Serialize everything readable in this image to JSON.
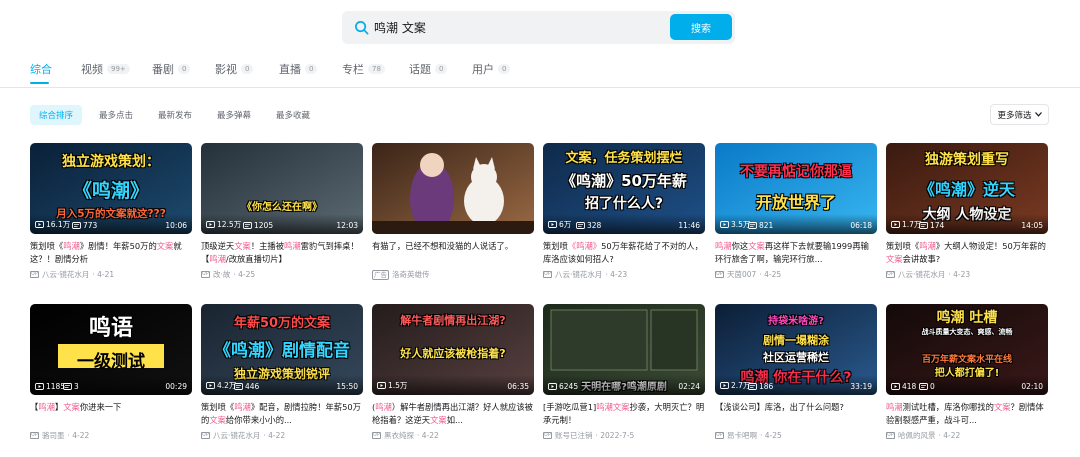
{
  "search": {
    "query": "鸣潮 文案",
    "button_label": "搜索"
  },
  "tabs": [
    {
      "label": "综合",
      "count": ""
    },
    {
      "label": "视频",
      "count": "99+"
    },
    {
      "label": "番剧",
      "count": "0"
    },
    {
      "label": "影视",
      "count": "0"
    },
    {
      "label": "直播",
      "count": "0"
    },
    {
      "label": "专栏",
      "count": "78"
    },
    {
      "label": "话题",
      "count": "0"
    },
    {
      "label": "用户",
      "count": "0"
    }
  ],
  "sort_options": [
    "综合排序",
    "最多点击",
    "最新发布",
    "最多弹幕",
    "最多收藏"
  ],
  "filter_label": "更多筛选",
  "colors": {
    "accent": "#00aeec",
    "highlight": "#f25d8e",
    "text": "#18191c",
    "muted": "#9499a0"
  },
  "cards": [
    {
      "thumb_lines": [
        "独立游戏策划：",
        "《鸣潮》",
        "月入5万的文案就这???"
      ],
      "views": "16.1万",
      "danmaku": "773",
      "duration": "10:06",
      "title_parts": [
        "策划喷《",
        "鸣潮",
        "》剧情！年薪50万的",
        "文案",
        "就这？！剧情分析"
      ],
      "up": "八云·镜花水月",
      "date": "4-21",
      "ad": false
    },
    {
      "thumb_lines": [
        "《你怎么还在啊》"
      ],
      "views": "12.5万",
      "danmaku": "1205",
      "duration": "12:03",
      "title_parts": [
        "顶级逆天",
        "文案",
        "！主播被",
        "鸣潮",
        "雷豹气到摔桌！【",
        "鸣潮",
        "/改放直播切片】"
      ],
      "up": "改·故",
      "date": "4-25",
      "ad": false
    },
    {
      "thumb_lines": [],
      "views": "",
      "danmaku": "",
      "duration": "",
      "title_parts": [
        "有猫了，已经不想和没猫的人说话了。"
      ],
      "up": "洛奇英雄传",
      "date": "",
      "ad": true,
      "ad_label": "广告"
    },
    {
      "thumb_lines": [
        "文案，任务策划摆烂",
        "《鸣潮》50万年薪",
        "招了什么人?"
      ],
      "views": "6万",
      "danmaku": "328",
      "duration": "11:46",
      "title_parts": [
        "策划喷",
        "《鸣潮》",
        "50万年薪花给了不对的人，库洛应该如何招人?"
      ],
      "up": "八云·镜花水月",
      "date": "4-23",
      "ad": false
    },
    {
      "thumb_lines": [
        "不要再惦记你那逼",
        "开放世界了"
      ],
      "views": "3.5万",
      "danmaku": "821",
      "duration": "06:18",
      "title_parts": [
        "",
        "鸣潮",
        "你这",
        "文案",
        "再这样下去就要输1999再输环行旅舍了啊，输完环行旅..."
      ],
      "up": "天茵007",
      "date": "4-25",
      "ad": false
    },
    {
      "thumb_lines": [
        "独游策划重写",
        "《鸣潮》逆天",
        "大纲 人物设定"
      ],
      "views": "1.7万",
      "danmaku": "174",
      "duration": "14:05",
      "title_parts": [
        "策划喷《",
        "鸣潮",
        "》大纲人物设定！50万年薪的",
        "文案",
        "会讲故事?"
      ],
      "up": "八云·镜花水月",
      "date": "4-23",
      "ad": false
    },
    {
      "thumb_lines": [
        "鸣语",
        "一级测试"
      ],
      "views": "1185",
      "danmaku": "3",
      "duration": "00:29",
      "title_parts": [
        "【",
        "鸣潮",
        "】",
        "文案",
        "你进来一下"
      ],
      "up": "骆司墨",
      "date": "4-22",
      "ad": false
    },
    {
      "thumb_lines": [
        "年薪50万的文案",
        "《鸣潮》剧情配音",
        "独立游戏策划锐评"
      ],
      "views": "4.2万",
      "danmaku": "446",
      "duration": "15:50",
      "title_parts": [
        "策划喷《",
        "鸣潮",
        "》配音，剧情拉胯！年薪50万的",
        "文案",
        "给你带来小小的..."
      ],
      "up": "八云·镜花水月",
      "date": "4-22",
      "ad": false
    },
    {
      "thumb_lines": [
        "解牛者剧情再出江湖?",
        "好人就应该被枪指着?"
      ],
      "views": "1.5万",
      "danmaku": "",
      "duration": "06:35",
      "title_parts": [
        "(",
        "鸣潮",
        "）解牛者剧情再出江湖？好人就应该被枪指着？这逆天",
        "文案",
        "如..."
      ],
      "up": "黑衣纯探",
      "date": "4-22",
      "ad": false
    },
    {
      "thumb_lines": [
        "天明在哪?鸣潮原剧"
      ],
      "views": "6245",
      "danmaku": "",
      "duration": "02:24",
      "title_parts": [
        "[手游吃瓜营1]",
        "鸣潮",
        "",
        "文案",
        "抄袭，大明灭亡？明承元制！"
      ],
      "up": "账号已注销",
      "date": "2022-7-5",
      "ad": false
    },
    {
      "thumb_lines": [
        "持袋米啥游?",
        "剧情一塌糊涂",
        "社区运营稀烂",
        "鸣潮 你在干什么?"
      ],
      "views": "2.7万",
      "danmaku": "186",
      "duration": "33:19",
      "title_parts": [
        "【浅谈公司】库洛，出了什么问题?"
      ],
      "up": "昂卡吧啊",
      "date": "4-25",
      "ad": false
    },
    {
      "thumb_lines": [
        "鸣潮 吐槽",
        "战斗质量大变态、爽感、流畅",
        "百万年薪文案水平在线",
        "把人都打偏了!"
      ],
      "views": "418",
      "danmaku": "0",
      "duration": "02:10",
      "title_parts": [
        "",
        "鸣潮",
        "测试吐槽，库洛你哪找的",
        "文案",
        "？剧情体验割裂感严重，战斗可..."
      ],
      "up": "哈佩的风景",
      "date": "4-22",
      "ad": false
    }
  ]
}
